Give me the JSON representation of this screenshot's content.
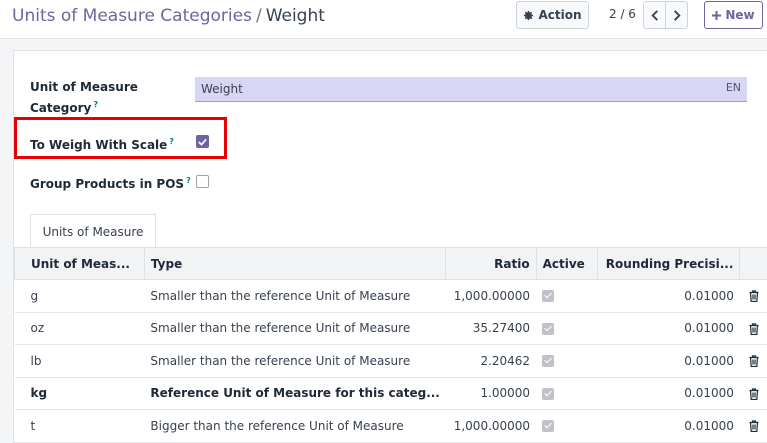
{
  "breadcrumb": {
    "parent": "Units of Measure Categories",
    "separator": "/",
    "current": "Weight"
  },
  "toolbar": {
    "action_label": "Action",
    "new_label": "New",
    "pager_value": "2 / 6"
  },
  "form": {
    "category_label_line1": "Unit of Measure",
    "category_label_line2": "Category",
    "tooltip_mark": "?",
    "category_value": "Weight",
    "lang_badge": "EN",
    "weigh_scale_label": "To Weigh With Scale",
    "weigh_scale_checked": true,
    "group_pos_label": "Group Products in POS",
    "group_pos_checked": false
  },
  "tabs": [
    {
      "label": "Units of Measure",
      "active": true
    }
  ],
  "table": {
    "columns": [
      "Unit of Meas...",
      "Type",
      "Ratio",
      "Active",
      "Rounding Precisi..."
    ],
    "rows": [
      {
        "unit": "g",
        "type": "Smaller than the reference Unit of Measure",
        "ratio": "1,000.00000",
        "active": true,
        "rounding": "0.01000",
        "bold": false
      },
      {
        "unit": "oz",
        "type": "Smaller than the reference Unit of Measure",
        "ratio": "35.27400",
        "active": true,
        "rounding": "0.01000",
        "bold": false
      },
      {
        "unit": "lb",
        "type": "Smaller than the reference Unit of Measure",
        "ratio": "2.20462",
        "active": true,
        "rounding": "0.01000",
        "bold": false
      },
      {
        "unit": "kg",
        "type": "Reference Unit of Measure for this categ...",
        "ratio": "1.00000",
        "active": true,
        "rounding": "0.01000",
        "bold": true
      },
      {
        "unit": "t",
        "type": "Bigger than the reference Unit of Measure",
        "ratio": "1,000.00000",
        "active": true,
        "rounding": "0.01000",
        "bold": false
      }
    ]
  },
  "colors": {
    "accent": "#71639e",
    "highlight": "#e60000",
    "input_bg": "#d8d6f4"
  }
}
